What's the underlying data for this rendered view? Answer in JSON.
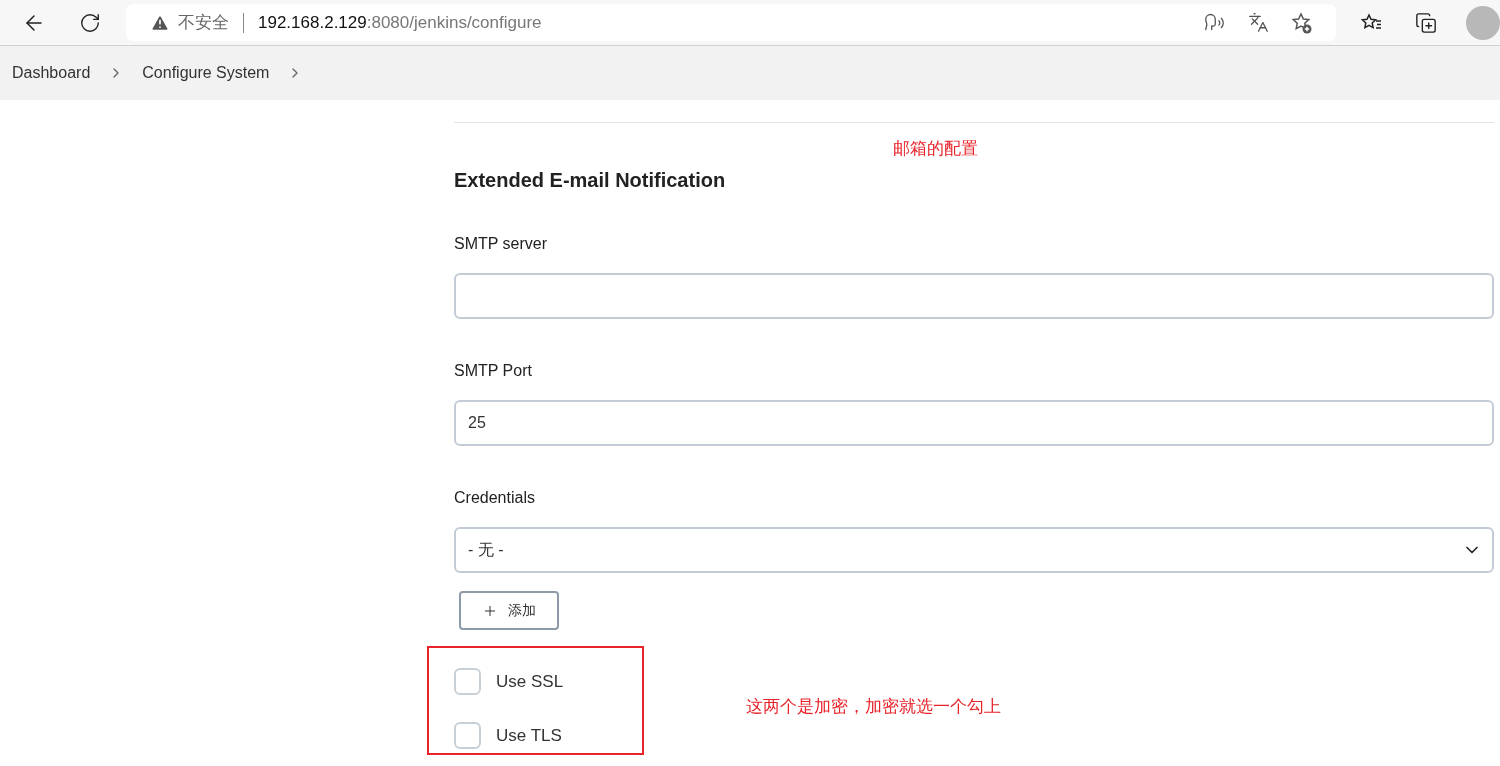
{
  "browser": {
    "security_label": "不安全",
    "url_host": "192.168.2.129",
    "url_path": ":8080/jenkins/configure"
  },
  "breadcrumbs": [
    {
      "label": "Dashboard"
    },
    {
      "label": "Configure System"
    }
  ],
  "section": {
    "title": "Extended E-mail Notification",
    "fields": [
      {
        "kind": "text",
        "label": "SMTP server"
      },
      {
        "kind": "text",
        "label": "SMTP Port",
        "value": "25"
      },
      {
        "kind": "select",
        "label": "Credentials",
        "value": "- 无 -"
      }
    ],
    "add_button": {
      "label": "添加"
    },
    "checkboxes": [
      {
        "label": "Use SSL",
        "checked": false
      },
      {
        "label": "Use TLS",
        "checked": false
      }
    ]
  },
  "annotations": [
    {
      "text": "邮箱的配置"
    },
    {
      "text": "这两个是加密，加密就选一个勾上"
    }
  ]
}
